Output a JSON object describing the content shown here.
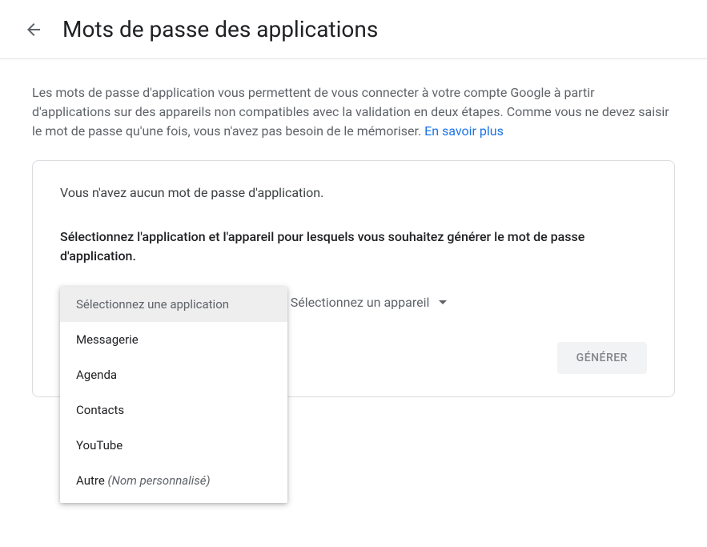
{
  "header": {
    "title": "Mots de passe des applications"
  },
  "description": {
    "text": "Les mots de passe d'application vous permettent de vous connecter à votre compte Google à partir d'applications sur des appareils non compatibles avec la validation en deux étapes. Comme vous ne devez saisir le mot de passe qu'une fois, vous n'avez pas besoin de le mémoriser. ",
    "learn_more": "En savoir plus"
  },
  "card": {
    "no_passwords": "Vous n'avez aucun mot de passe d'application.",
    "select_prompt": "Sélectionnez l'application et l'appareil pour lesquels vous souhaitez générer le mot de passe d'application.",
    "app_dropdown": {
      "placeholder": "Sélectionnez une application",
      "options": {
        "placeholder": "Sélectionnez une application",
        "mail": "Messagerie",
        "calendar": "Agenda",
        "contacts": "Contacts",
        "youtube": "YouTube",
        "other_prefix": "Autre ",
        "other_suffix": "(Nom personnalisé)"
      }
    },
    "device_dropdown": {
      "placeholder": "Sélectionnez un appareil"
    },
    "generate_label": "GÉNÉRER"
  }
}
